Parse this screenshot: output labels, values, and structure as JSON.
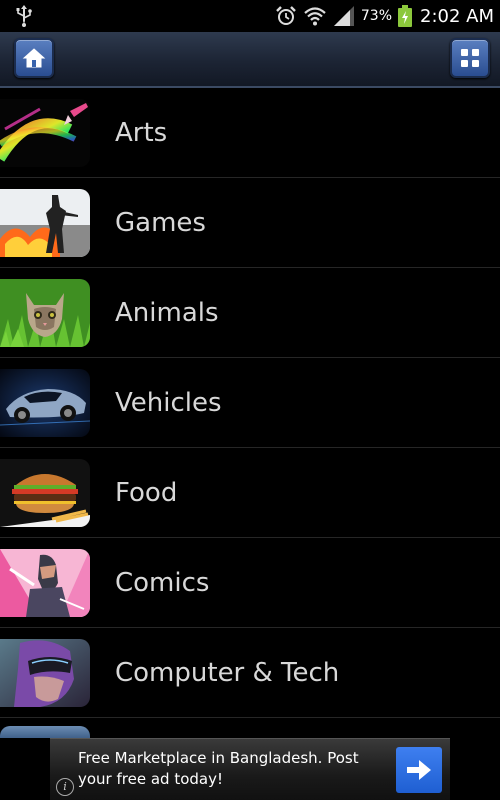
{
  "status_bar": {
    "battery_percent": "73%",
    "time": "2:02 AM",
    "icons": [
      "usb-icon",
      "alarm-icon",
      "wifi-icon",
      "signal-icon",
      "battery-charging-icon"
    ]
  },
  "action_bar": {
    "left_button_icon": "home-icon",
    "right_button_icon": "grid-icon"
  },
  "categories": [
    {
      "label": "Arts",
      "thumb": "arts"
    },
    {
      "label": "Games",
      "thumb": "games"
    },
    {
      "label": "Animals",
      "thumb": "animals"
    },
    {
      "label": "Vehicles",
      "thumb": "vehicles"
    },
    {
      "label": "Food",
      "thumb": "food"
    },
    {
      "label": "Comics",
      "thumb": "comics"
    },
    {
      "label": "Computer & Tech",
      "thumb": "tech"
    }
  ],
  "ad": {
    "text": "Free Marketplace in Bangladesh. Post your free ad today!",
    "info_glyph": "i",
    "arrow_icon": "arrow-right-icon"
  },
  "colors": {
    "background": "#000000",
    "label": "#d8d8d8",
    "action_bar_button": "#3f67b0",
    "ad_button": "#2f6fe4"
  }
}
